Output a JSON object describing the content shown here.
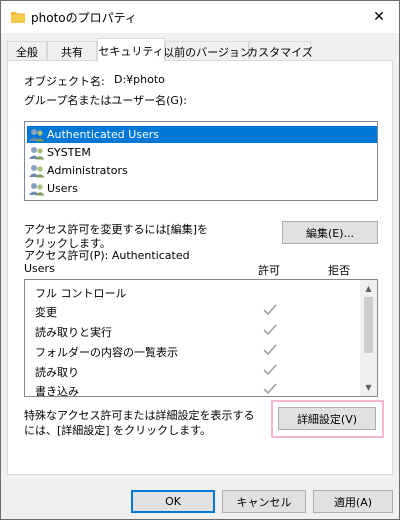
{
  "window": {
    "title": "photoのプロパティ",
    "close_glyph": "✕"
  },
  "tabs": [
    {
      "label": "全般"
    },
    {
      "label": "共有"
    },
    {
      "label": "セキュリティ",
      "active": true
    },
    {
      "label": "以前のバージョン"
    },
    {
      "label": "カスタマイズ"
    }
  ],
  "security": {
    "object_name_label": "オブジェクト名:",
    "object_name_value": "D:¥photo",
    "group_label": "グループ名またはユーザー名(G):",
    "users": [
      {
        "name": "Authenticated Users",
        "selected": true
      },
      {
        "name": "SYSTEM"
      },
      {
        "name": "Administrators"
      },
      {
        "name": "Users"
      }
    ],
    "change_hint_line1": "アクセス許可を変更するには[編集]を",
    "change_hint_line2": "クリックします。",
    "edit_button": "編集(E)...",
    "permissions_for_line1": "アクセス許可(P): Authenticated",
    "permissions_for_line2": "Users",
    "allow_header": "許可",
    "deny_header": "拒否",
    "permissions": [
      {
        "name": "フル コントロール",
        "allow": false
      },
      {
        "name": "変更",
        "allow": true
      },
      {
        "name": "読み取りと実行",
        "allow": true
      },
      {
        "name": "フォルダーの内容の一覧表示",
        "allow": true
      },
      {
        "name": "読み取り",
        "allow": true
      },
      {
        "name": "書き込み",
        "allow": true
      }
    ],
    "advanced_hint_line1": "特殊なアクセス許可または詳細設定を表示する",
    "advanced_hint_line2": "には、[詳細設定] をクリックします。",
    "advanced_button": "詳細設定(V)"
  },
  "footer": {
    "ok": "OK",
    "cancel": "キャンセル",
    "apply": "適用(A)"
  },
  "colors": {
    "selection": "#0078d7",
    "highlight": "#f4b6d2",
    "check": "#a0a0a0"
  },
  "icons": {
    "folder": "folder-icon",
    "close": "close-icon",
    "user_group": "user-group-icon",
    "check": "check-icon"
  }
}
